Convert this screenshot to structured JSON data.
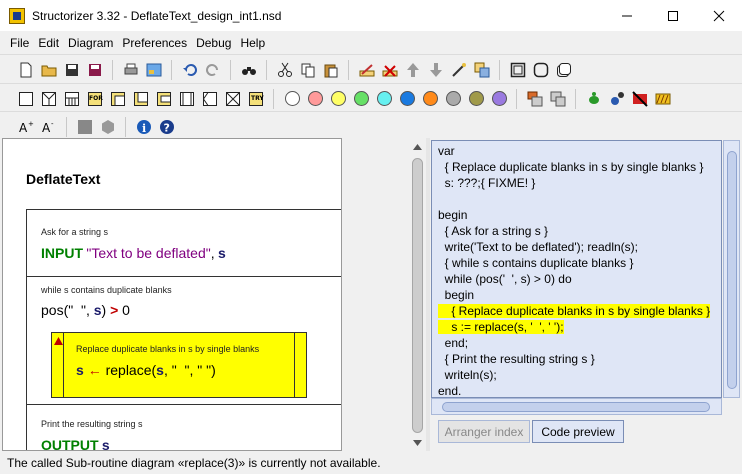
{
  "window": {
    "title": "Structorizer 3.32 - DeflateText_design_int1.nsd"
  },
  "menubar": {
    "items": [
      "File",
      "Edit",
      "Diagram",
      "Preferences",
      "Debug",
      "Help"
    ]
  },
  "diagram": {
    "title": "DeflateText",
    "blocks": {
      "input": {
        "comment": "Ask for a string s",
        "keyword": "INPUT",
        "string": "\"Text to be deflated\"",
        "sep": ",",
        "var": "s"
      },
      "loop": {
        "comment": "while s contains duplicate blanks",
        "cond_pre": "pos(\"  \", ",
        "cond_var": "s",
        "cond_close": ")",
        "cond_op": ">",
        "cond_val": "0"
      },
      "call": {
        "comment": "Replace duplicate blanks in s by single blanks",
        "var": "s",
        "arrow": "←",
        "expr_pre": "replace(",
        "expr_var": "s",
        "expr_post": ", \"  \", \" \")"
      },
      "output": {
        "comment": "Print the resulting string s",
        "keyword": "OUTPUT",
        "var": "s"
      }
    }
  },
  "code_preview": {
    "lines": [
      "var",
      "  { Replace duplicate blanks in s by single blanks }",
      "  s: ???;{ FIXME! }",
      "",
      "begin",
      "  { Ask for a string s }",
      "  write('Text to be deflated'); readln(s);",
      "  { while s contains duplicate blanks }",
      "  while (pos('  ', s) > 0) do",
      "  begin",
      "    { Replace duplicate blanks in s by single blanks }",
      "    s := replace(s, '  ', ' ');",
      "  end;",
      "  { Print the resulting string s }",
      "  writeln(s);",
      "end."
    ]
  },
  "tabs": {
    "arranger": "Arranger index",
    "code": "Code preview"
  },
  "status": {
    "text": "The called Sub-routine diagram «replace(3)» is currently not available."
  }
}
